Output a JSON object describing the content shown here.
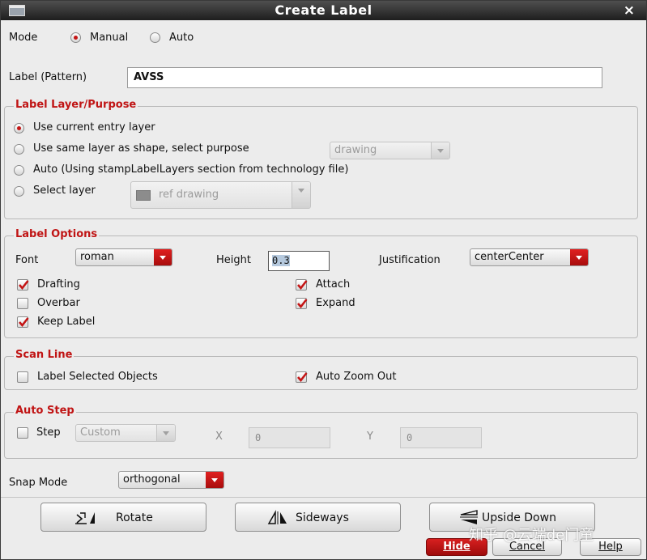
{
  "window": {
    "title": "Create Label",
    "close_symbol": "×"
  },
  "mode": {
    "label": "Mode",
    "options": [
      "Manual",
      "Auto"
    ],
    "selected": "Manual"
  },
  "label_pattern": {
    "label": "Label (Pattern)",
    "value": "AVSS"
  },
  "layer_purpose": {
    "title": "Label Layer/Purpose",
    "options": [
      "Use current entry layer",
      "Use same layer as shape, select purpose",
      "Auto (Using stampLabelLayers section from technology file)",
      "Select layer"
    ],
    "selected": "Use current entry layer",
    "purpose_value": "drawing",
    "select_layer_value": "ref drawing"
  },
  "label_options": {
    "title": "Label Options",
    "font_label": "Font",
    "font_value": "roman",
    "height_label": "Height",
    "height_value": "0.3",
    "justification_label": "Justification",
    "justification_value": "centerCenter",
    "checks": [
      {
        "label": "Drafting",
        "checked": true
      },
      {
        "label": "Overbar",
        "checked": false
      },
      {
        "label": "Keep Label",
        "checked": true
      },
      {
        "label": "Attach",
        "checked": true
      },
      {
        "label": "Expand",
        "checked": true
      }
    ]
  },
  "scan_line": {
    "title": "Scan Line",
    "checks": [
      {
        "label": "Label Selected Objects",
        "checked": false
      },
      {
        "label": "Auto Zoom Out",
        "checked": true
      }
    ]
  },
  "auto_step": {
    "title": "Auto Step",
    "step_label": "Step",
    "step_checked": false,
    "step_value": "Custom",
    "x_label": "X",
    "x_value": "0",
    "y_label": "Y",
    "y_value": "0"
  },
  "snap_mode": {
    "label": "Snap Mode",
    "value": "orthogonal"
  },
  "buttons": {
    "rotate": "Rotate",
    "sideways": "Sideways",
    "upside_down": "Upside Down",
    "hide": "Hide",
    "cancel": "Cancel",
    "help": "Help"
  },
  "watermark": "知乎 @云端de门童",
  "colors": {
    "accent": "#c41515",
    "title_bar": "#2a2a2a",
    "background": "#ececec"
  }
}
